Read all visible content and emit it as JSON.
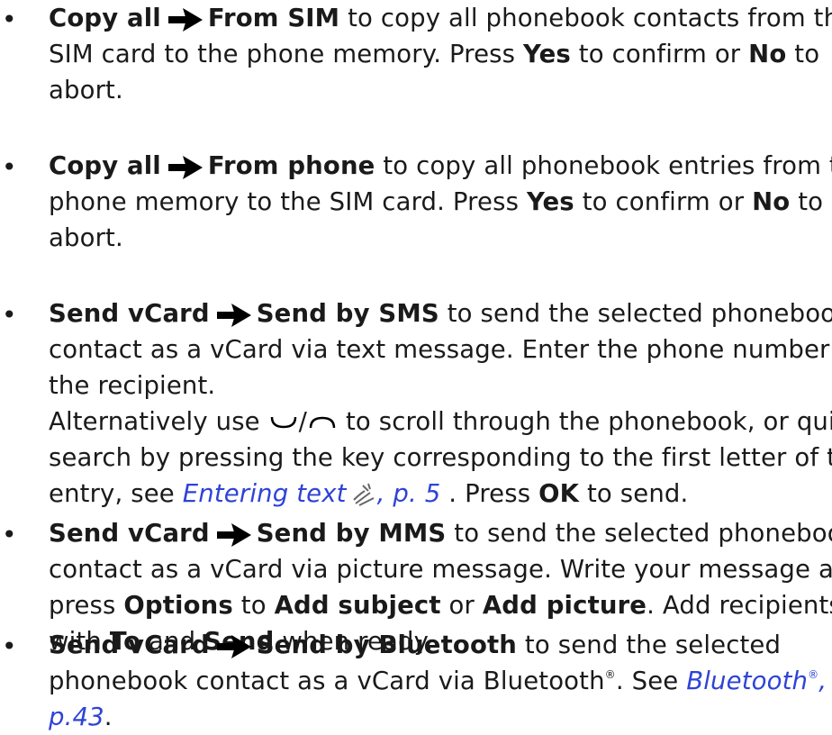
{
  "bullets": [
    {
      "part1": "Copy all",
      "part2": "From SIM",
      "text": " to copy all phonebook contacts from the SIM card to the phone memory. Press ",
      "yes": "Yes",
      "mid": " to confirm or ",
      "no": "No",
      "end": " to abort."
    },
    {
      "part1": "Copy all",
      "part2": "From phone",
      "text": " to copy all phonebook entries from the phone memory to the SIM card. Press ",
      "yes": "Yes",
      "mid": " to confirm or ",
      "no": "No",
      "end": " to abort."
    },
    {
      "part1": "Send vCard",
      "part2": "Send by SMS",
      "text": " to send the selected phonebook contact as a vCard via text message. Enter the phone number of the recipient.",
      "alt_prefix": "Alternatively use ",
      "alt_sep": "/",
      "alt_rest": " to scroll through the phonebook, or quick search by pressing the key corresponding to the first letter of the entry, see ",
      "link_text": "Entering text",
      "link_page": ", p. 5",
      "after_link": " . Press ",
      "ok": "OK",
      "end": " to send."
    },
    {
      "part1": "Send vCard",
      "part2": "Send by MMS",
      "text": " to send the selected phonebook contact as a vCard via picture message. Write your message and press ",
      "options": "Options",
      "to1": " to ",
      "add_subject": "Add subject",
      "or": " or ",
      "add_picture": "Add picture",
      "mid": ". Add recipients with ",
      "to_label": "To",
      "and": " and ",
      "send_label": "Send",
      "end": " when ready."
    },
    {
      "part1": "Send vCard",
      "part2": "Send by Bluetooth",
      "text": " to send the selected phonebook contact as a vCard via Bluetooth",
      "reg": "®",
      "see": ". See ",
      "link_text": "Bluetooth",
      "link_reg": "®",
      "link_page": ", p.43",
      "end": "."
    }
  ],
  "bullet_char": "•",
  "icons": {
    "arrow": "right-arrow-icon",
    "key_down": "scroll-down-key-icon",
    "key_up": "scroll-up-key-icon",
    "hand": "hand-pointer-icon"
  },
  "colors": {
    "link": "#2e43d6",
    "text": "#1a1a1a"
  }
}
